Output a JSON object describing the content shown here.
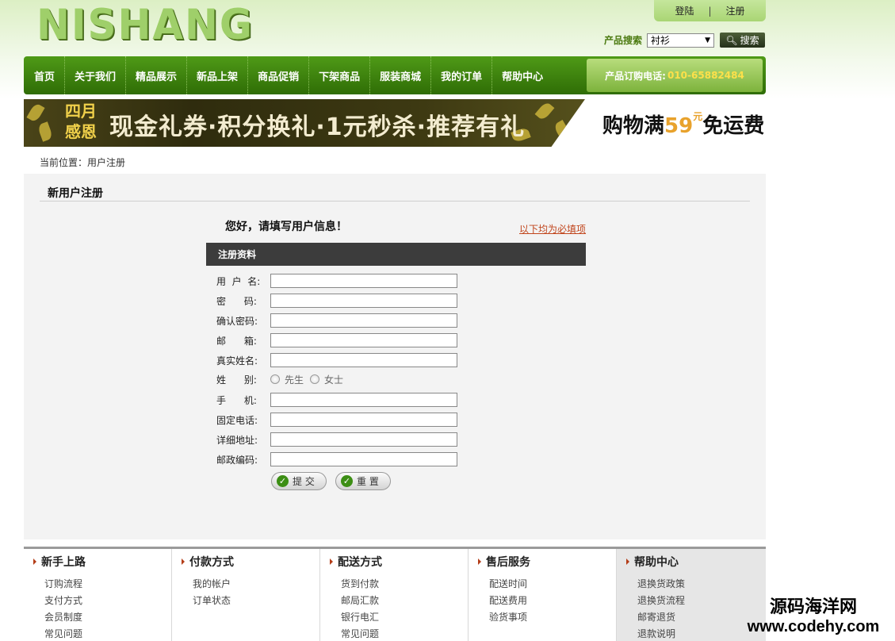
{
  "header": {
    "logo": "NISHANG",
    "login": "登陆",
    "sep": "|",
    "register": "注册",
    "search_label": "产品搜索",
    "search_value": "衬衫",
    "search_button": "搜索"
  },
  "nav": {
    "items": [
      "首页",
      "关于我们",
      "精品展示",
      "新品上架",
      "商品促销",
      "下架商品",
      "服装商城",
      "我的订单",
      "帮助中心"
    ],
    "phone_label": "产品订购电话:",
    "phone": "010-65882484"
  },
  "banner": {
    "badge_line1": "四月",
    "badge_line2": "感恩",
    "text": "现金礼券·积分换礼·1元秒杀·推荐有礼",
    "right_prefix": "购物满",
    "right_amount": "59",
    "right_unit": "元",
    "right_suffix": "免运费"
  },
  "breadcrumb": "当前位置：用户注册",
  "content": {
    "title": "新用户注册",
    "hello": "您好，请填写用户信息！",
    "required_link": "以下均为必填项",
    "form_head": "注册资料",
    "fields": [
      {
        "label": "用  户  名:",
        "value": ""
      },
      {
        "label": "密      码:",
        "value": ""
      },
      {
        "label": "确认密码:",
        "value": ""
      },
      {
        "label": "邮      箱:",
        "value": ""
      },
      {
        "label": "真实姓名:",
        "value": ""
      }
    ],
    "gender_label": "姓      别:",
    "gender_options": [
      "先生",
      "女士"
    ],
    "fields2": [
      {
        "label": "手      机:",
        "value": ""
      },
      {
        "label": "固定电话:",
        "value": ""
      },
      {
        "label": "详细地址:",
        "value": ""
      },
      {
        "label": "邮政编码:",
        "value": ""
      }
    ],
    "submit": "提 交",
    "reset": "重 置"
  },
  "footer": [
    {
      "title": "新手上路",
      "links": [
        "订购流程",
        "支付方式",
        "会员制度",
        "常见问题"
      ]
    },
    {
      "title": "付款方式",
      "links": [
        "我的帐户",
        "订单状态"
      ]
    },
    {
      "title": "配送方式",
      "links": [
        "货到付款",
        "邮局汇款",
        "银行电汇",
        "常见问题"
      ]
    },
    {
      "title": "售后服务",
      "links": [
        "配送时间",
        "配送费用",
        "验货事项"
      ]
    },
    {
      "title": "帮助中心",
      "links": [
        "退换货政策",
        "退换货流程",
        "邮寄退货",
        "退款说明"
      ]
    }
  ],
  "watermark": {
    "line1": "源码海洋网",
    "line2": "www.codehy.com"
  },
  "colors": {
    "nav": "#3f8510",
    "accent_link": "#c1451c",
    "form_head": "#3c3c3c"
  }
}
